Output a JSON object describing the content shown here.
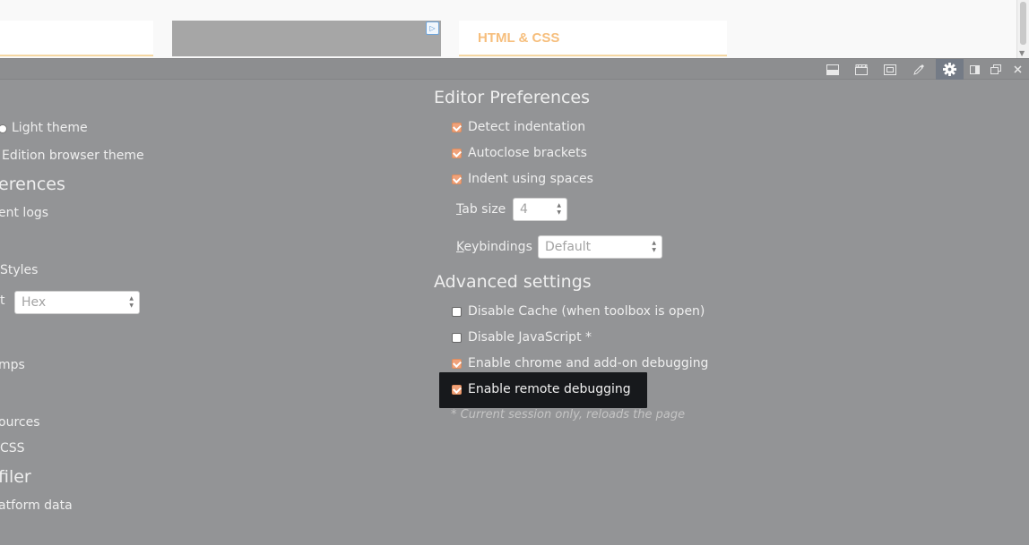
{
  "page": {
    "html_card_title": "HTML & CSS",
    "ad_badge": "▷"
  },
  "toolbar": {
    "active_tool": "settings",
    "accent_color": "#747b86"
  },
  "left_column": {
    "light_theme": "Light theme",
    "browser_theme": "Edition browser theme",
    "heading_preferences": "erences",
    "persistent_logs": "ent logs",
    "styles": "Styles",
    "color_unit_label": "t",
    "color_unit_value": "Hex",
    "timestamps": "mps",
    "sources": "ources",
    "css": "CSS",
    "heading_profiler": "filer",
    "platform_data": "atform data"
  },
  "editor": {
    "heading": "Editor Preferences",
    "detect_indentation": "Detect indentation",
    "autoclose_brackets": "Autoclose brackets",
    "indent_using_spaces": "Indent using spaces",
    "tab_size_label": "ab size",
    "tab_size_accesskey": "T",
    "tab_size_value": "4",
    "keybindings_label": "eybindings",
    "keybindings_accesskey": "K",
    "keybindings_value": "Default"
  },
  "advanced": {
    "heading": "Advanced settings",
    "disable_cache": "Disable Cache (when toolbox is open)",
    "disable_javascript": "Disable JavaScript *",
    "chrome_debugging": "Enable chrome and add-on debugging",
    "remote_debugging": "Enable remote debugging",
    "note": "* Current session only, reloads the page"
  },
  "colors": {
    "checkbox_checked": "#f0a27a",
    "panel_bg": "#939496",
    "html_card_text": "#f6be7c"
  }
}
